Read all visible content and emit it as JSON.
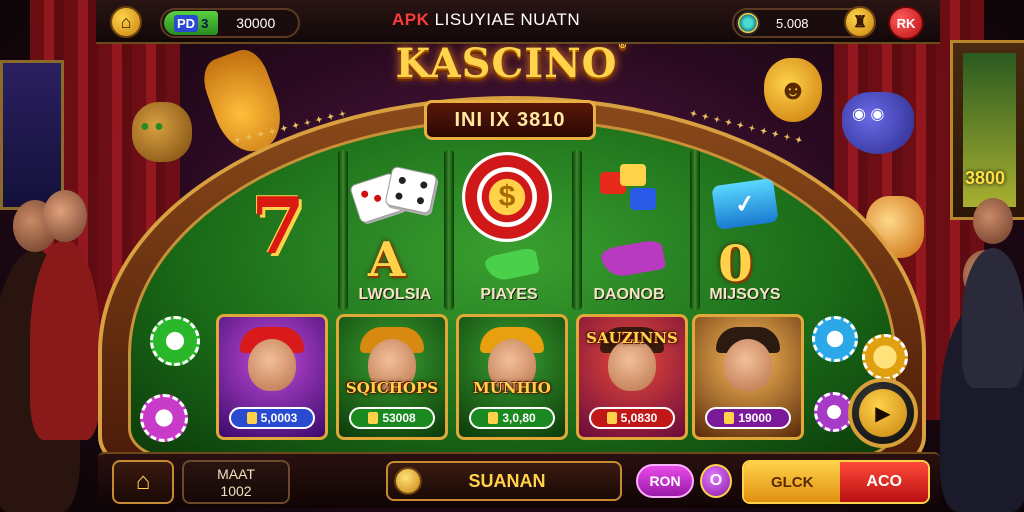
{
  "topbar": {
    "home_icon": "home-icon",
    "balance_tag_box": "PD",
    "balance_tag_num": "3",
    "balance_value": "30000",
    "app_title_prefix": "APK",
    "app_title_rest": "LISUYIAE NUATN",
    "coin_value": "5.008",
    "bag_icon": "bag-icon",
    "rk_label": "RK"
  },
  "logo": {
    "title": "KASCINO",
    "mark": "®",
    "plaque": "INI IX 3810"
  },
  "columns": [
    {
      "label": "LWOLSIA",
      "symbol": "7"
    },
    {
      "label": "PLAYES",
      "symbol": "A"
    },
    {
      "label": "PLAYES"
    },
    {
      "label": "DAONOB"
    },
    {
      "label": "MIJSOYS",
      "symbol": "0"
    }
  ],
  "col_labels": [
    "LWOLSIA",
    "PIAYES",
    "DAONOB",
    "MIJSOYS"
  ],
  "tiles": [
    {
      "title": "",
      "price": "5,0003",
      "color": "#6a2a9a",
      "price_bg": "#2a4ad0"
    },
    {
      "title": "SQICHOPS",
      "price": "53008",
      "color": "#1a6a18",
      "price_bg": "#1a8a20"
    },
    {
      "title": "MUNHIO",
      "price": "3,0,80",
      "color": "#1a6a18",
      "price_bg": "#1a8a20"
    },
    {
      "title": "SAUZINNS",
      "price": "5,0830",
      "color": "#8a1a7a",
      "price_bg": "#c01818"
    },
    {
      "title": "",
      "price": "19000",
      "color": "#5a2a10",
      "price_bg": "#7a1a9a"
    }
  ],
  "play_icon": "play-icon",
  "bottombar": {
    "home_icon": "home-icon",
    "info_line1": "MAAT",
    "info_line2": "1002",
    "main_label": "SUANAN",
    "ron_label": "RON",
    "purple_label": "O",
    "action_left": "GLCK",
    "action_right": "ACO"
  },
  "wall_screen_text": "3800",
  "colors": {
    "gold": "#ffd24a",
    "felt": "#1a6a18",
    "accent_red": "#d81a10"
  }
}
